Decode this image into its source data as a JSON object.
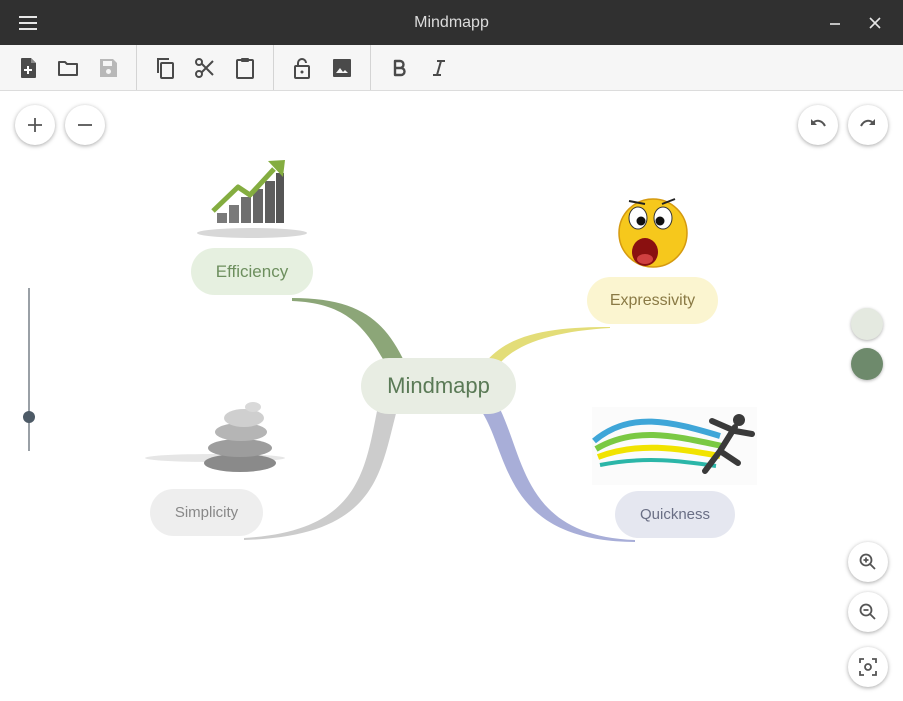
{
  "window": {
    "title": "Mindmapp"
  },
  "mindmap": {
    "root": {
      "label": "Mindmapp",
      "color": "#e8ede3",
      "text_color": "#5a7a56"
    },
    "nodes": [
      {
        "id": "efficiency",
        "label": "Efficiency",
        "color": "#e6f0e0",
        "text_color": "#6d8f5e",
        "branch_color": "#8ca678"
      },
      {
        "id": "expressivity",
        "label": "Expressivity",
        "color": "#fbf5d0",
        "text_color": "#8a7a45",
        "branch_color": "#e3dd78"
      },
      {
        "id": "simplicity",
        "label": "Simplicity",
        "color": "#eeeeee",
        "text_color": "#888888",
        "branch_color": "#cccccc"
      },
      {
        "id": "quickness",
        "label": "Quickness",
        "color": "#e5e7f0",
        "text_color": "#6a6f85",
        "branch_color": "#a8aed8"
      }
    ]
  },
  "colors": {
    "background_swatch": "#e4e9e0",
    "branch_swatch": "#6e8a6c",
    "titlebar": "#303030"
  },
  "zoom_slider": {
    "level": 0.0
  }
}
